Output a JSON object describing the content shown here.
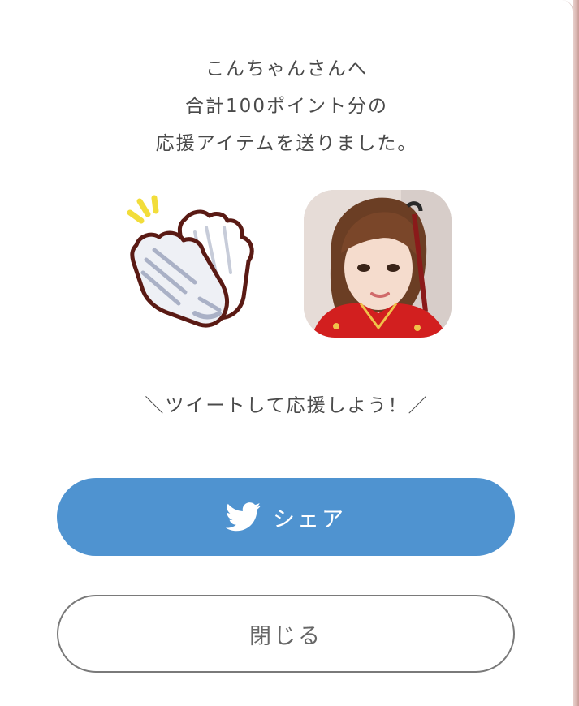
{
  "message": {
    "line1": "こんちゃんさんへ",
    "line2": "合計100ポイント分の",
    "line3": "応援アイテムを送りました。"
  },
  "item": {
    "icon": "clapping-hands-icon"
  },
  "recipient": {
    "avatar": "recipient-avatar"
  },
  "tweet_prompt": "＼ツイートして応援しよう！／",
  "share_button": {
    "label": "シェア",
    "icon": "twitter-icon",
    "color": "#4f93d0"
  },
  "close_button": {
    "label": "閉じる"
  }
}
